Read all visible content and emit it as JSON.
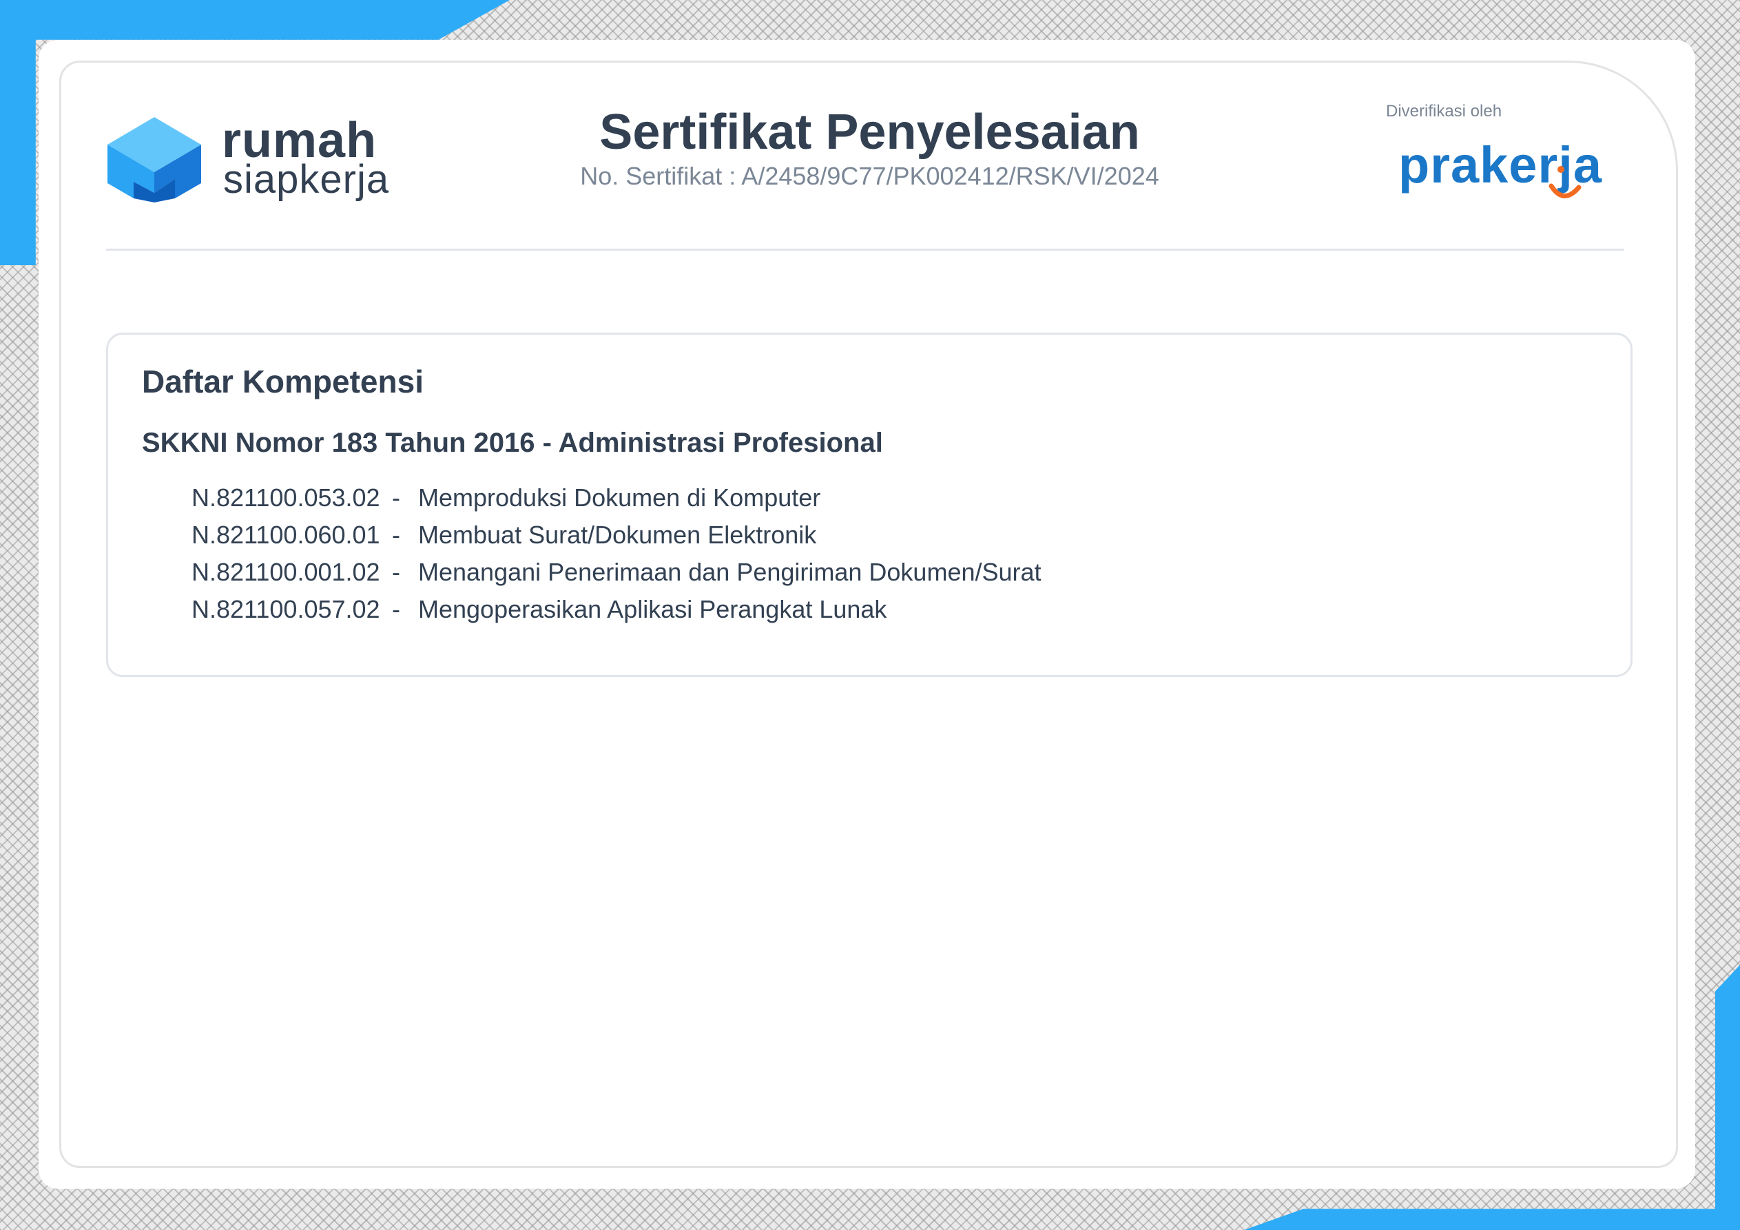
{
  "header": {
    "brand_line1": "rumah",
    "brand_line2": "siapkerja",
    "title": "Sertifikat Penyelesaian",
    "certificate_number": "No. Sertifikat : A/2458/9C77/PK002412/RSK/VI/2024",
    "verified_by_label": "Diverifikasi oleh",
    "partner_logo_text": "prakerja",
    "brand_icon": "cube-house-icon",
    "partner_icon": "prakerja-smile-icon"
  },
  "competency": {
    "heading": "Daftar Kompetensi",
    "standard": "SKKNI Nomor 183 Tahun 2016 - Administrasi Profesional",
    "units": [
      {
        "code": "N.821100.053.02",
        "separator": "-",
        "name": "Memproduksi Dokumen di Komputer"
      },
      {
        "code": "N.821100.060.01",
        "separator": "-",
        "name": "Membuat Surat/Dokumen Elektronik"
      },
      {
        "code": "N.821100.001.02",
        "separator": "-",
        "name": "Menangani Penerimaan dan Pengiriman Dokumen/Surat"
      },
      {
        "code": "N.821100.057.02",
        "separator": "-",
        "name": "Mengoperasikan Aplikasi Perangkat Lunak"
      }
    ]
  },
  "colors": {
    "accent_blue": "#2eabf6",
    "text_dark": "#324052",
    "text_muted": "#7b8796",
    "prakerja_blue": "#1b78c8",
    "prakerja_orange": "#f26b21"
  }
}
